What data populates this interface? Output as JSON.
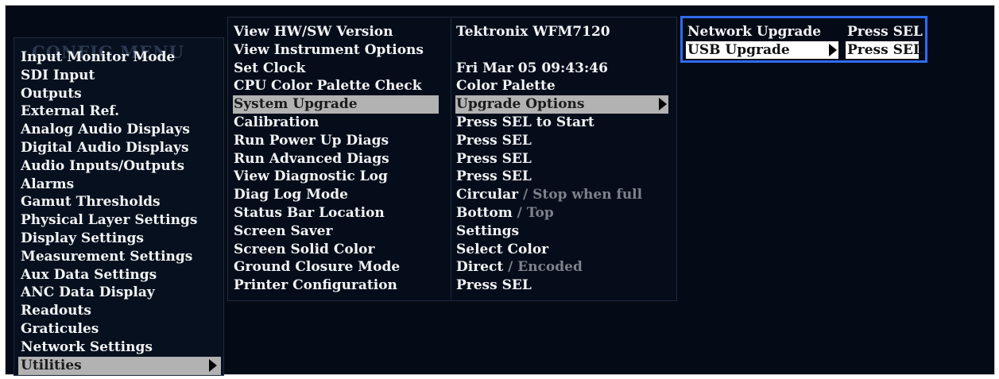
{
  "config_menu": {
    "title": "CONFIG MENU",
    "items": [
      {
        "label": "Input Monitor Mode"
      },
      {
        "label": "SDI Input"
      },
      {
        "label": "Outputs"
      },
      {
        "label": "External Ref."
      },
      {
        "label": "Analog Audio Displays"
      },
      {
        "label": "Digital Audio Displays"
      },
      {
        "label": "Audio Inputs/Outputs"
      },
      {
        "label": "Alarms"
      },
      {
        "label": "Gamut Thresholds"
      },
      {
        "label": "Physical Layer Settings"
      },
      {
        "label": "Display Settings"
      },
      {
        "label": "Measurement Settings"
      },
      {
        "label": "Aux Data Settings"
      },
      {
        "label": "ANC Data Display"
      },
      {
        "label": "Readouts"
      },
      {
        "label": "Graticules"
      },
      {
        "label": "Network Settings"
      },
      {
        "label": "Utilities",
        "selected": true
      }
    ]
  },
  "utilities_menu": {
    "rows": [
      {
        "label": "View HW/SW Version",
        "value": "Tektronix WFM7120"
      },
      {
        "label": "View Instrument Options",
        "value": ""
      },
      {
        "label": "Set Clock",
        "value": "Fri Mar 05 09:43:46"
      },
      {
        "label": "CPU Color Palette Check",
        "value": "Color Palette"
      },
      {
        "label": "System Upgrade",
        "value": "Upgrade Options",
        "selected": true
      },
      {
        "label": "Calibration",
        "value": "Press SEL to Start"
      },
      {
        "label": "Run Power Up Diags",
        "value": "Press SEL"
      },
      {
        "label": "Run Advanced Diags",
        "value": "Press SEL"
      },
      {
        "label": "View Diagnostic Log",
        "value": "Press SEL"
      },
      {
        "label": "Diag Log Mode",
        "value": "Circular",
        "sep": " / ",
        "alt": "Stop when full"
      },
      {
        "label": "Status Bar Location",
        "value": "Bottom",
        "sep": " / ",
        "alt": "Top"
      },
      {
        "label": "Screen Saver",
        "value": "Settings"
      },
      {
        "label": "Screen Solid Color",
        "value": "Select Color"
      },
      {
        "label": "Ground Closure Mode",
        "value": "Direct",
        "sep": " / ",
        "alt": "Encoded"
      },
      {
        "label": "Printer Configuration",
        "value": "Press SEL"
      }
    ]
  },
  "upgrade_submenu": {
    "rows": [
      {
        "label": "Network Upgrade",
        "value": "Press SEL"
      },
      {
        "label": "USB Upgrade",
        "value": "Press SEL",
        "selected": true
      }
    ]
  },
  "colors": {
    "background": "#050b16",
    "highlight": "#b2b2b2",
    "focus_border": "#2f6bf0",
    "text": "#f2f4f6",
    "dim_text": "#7c828a"
  }
}
